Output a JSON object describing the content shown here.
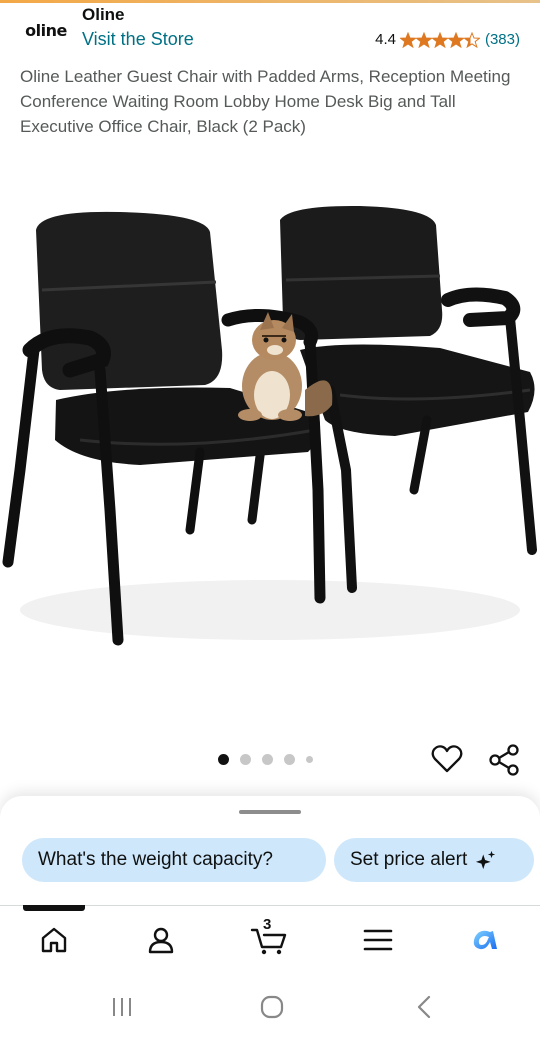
{
  "store": {
    "logo_text": "oline",
    "brand_name": "Oline",
    "visit_link": "Visit the Store"
  },
  "rating": {
    "value": "4.4",
    "stars": 4.4,
    "count": "(383)",
    "star_color": "#de7921"
  },
  "product": {
    "title": "Oline Leather Guest Chair with Padded Arms, Reception Meeting Conference Waiting Room Lobby Home Desk Big and Tall Executive Office Chair, Black (2 Pack)",
    "image_alt": "two black leather guest chairs with a chipmunk on a seat"
  },
  "carousel": {
    "dot_count": 5,
    "active_index": 0
  },
  "actions": {
    "favorite_icon": "heart-icon",
    "share_icon": "share-icon"
  },
  "suggestions": {
    "question_chip": "What's the weight capacity?",
    "price_alert_chip": "Set price alert"
  },
  "tabbar": {
    "items": [
      "home-icon",
      "account-icon",
      "cart-icon",
      "menu-icon",
      "rufus-icon"
    ],
    "cart_count": "3",
    "active_index": 0
  },
  "system_nav": [
    "recent-apps-icon",
    "home-circle-icon",
    "back-icon"
  ],
  "colors": {
    "link": "#007185",
    "chip_bg": "#cfe7fb",
    "rufus_blue": "#1a98ff"
  }
}
